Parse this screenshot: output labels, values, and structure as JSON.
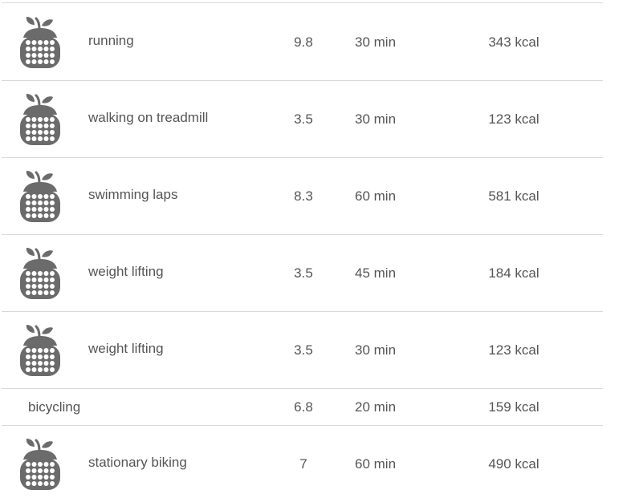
{
  "activities": [
    {
      "name": "running",
      "met": "9.8",
      "duration": "30 min",
      "calories": "343 kcal",
      "icon": "apple-calculator-icon"
    },
    {
      "name": "walking on treadmill",
      "met": "3.5",
      "duration": "30 min",
      "calories": "123 kcal",
      "icon": "apple-calculator-icon"
    },
    {
      "name": "swimming laps",
      "met": "8.3",
      "duration": "60 min",
      "calories": "581 kcal",
      "icon": "apple-calculator-icon"
    },
    {
      "name": "weight lifting",
      "met": "3.5",
      "duration": "45 min",
      "calories": "184 kcal",
      "icon": "apple-calculator-icon"
    },
    {
      "name": "weight lifting",
      "met": "3.5",
      "duration": "30 min",
      "calories": "123 kcal",
      "icon": "apple-calculator-icon"
    },
    {
      "name": "bicycling",
      "met": "6.8",
      "duration": "20 min",
      "calories": "159 kcal",
      "icon": null
    },
    {
      "name": "stationary biking",
      "met": "7",
      "duration": "60 min",
      "calories": "490 kcal",
      "icon": "apple-calculator-icon"
    }
  ],
  "colors": {
    "text": "#555555",
    "icon": "#6b6b6b",
    "divider": "#d9d9d9"
  }
}
